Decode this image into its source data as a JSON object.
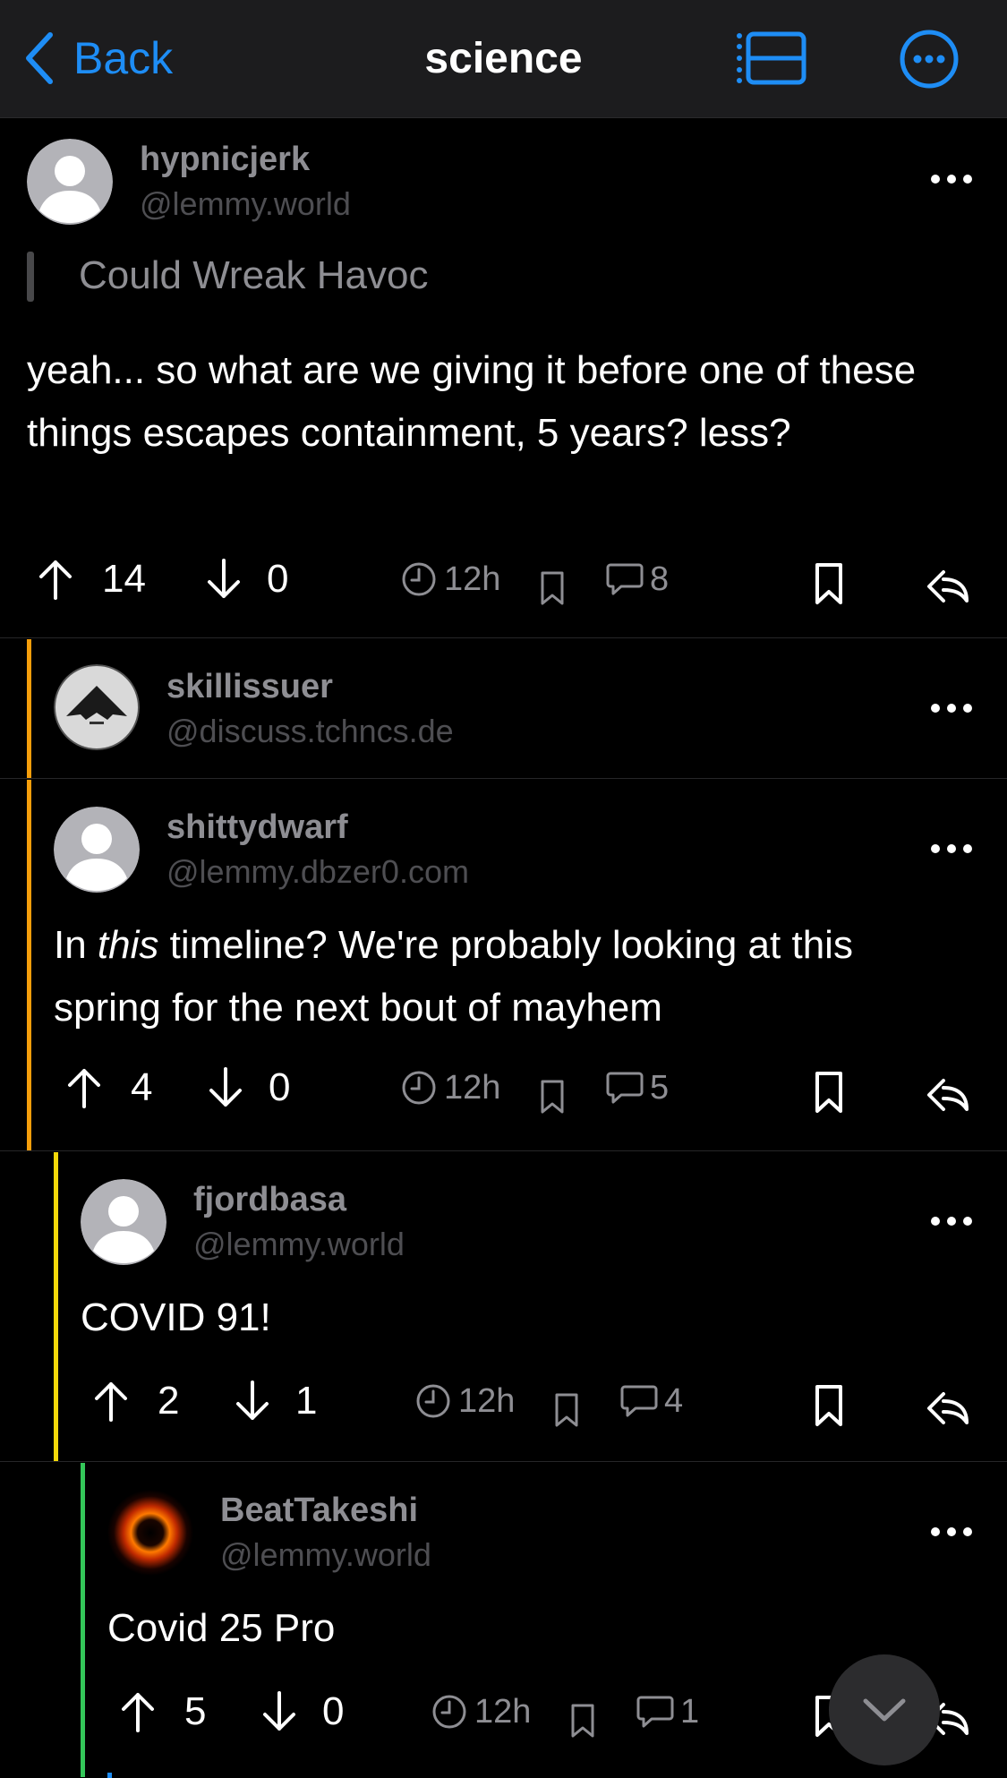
{
  "nav": {
    "back_label": "Back",
    "title": "science"
  },
  "comments": [
    {
      "username": "hypnicjerk",
      "instance": "@lemmy.world",
      "quote": "Could Wreak Havoc",
      "body": "yeah... so what are we giving it before one of these things escapes containment, 5 years? less?",
      "upvotes": "14",
      "downvotes": "0",
      "age": "12h",
      "replies": "8"
    },
    {
      "username": "skillissuer",
      "instance": "@discuss.tchncs.de",
      "depth_color": "#f59e0b"
    },
    {
      "username": "shittydwarf",
      "instance": "@lemmy.dbzer0.com",
      "body_pre": "In ",
      "body_em": "this",
      "body_post": " timeline? We're probably looking at this spring for the next bout of mayhem",
      "upvotes": "4",
      "downvotes": "0",
      "age": "12h",
      "replies": "5",
      "depth_color": "#f59e0b"
    },
    {
      "username": "fjordbasa",
      "instance": "@lemmy.world",
      "body": "COVID 91!",
      "upvotes": "2",
      "downvotes": "1",
      "age": "12h",
      "replies": "4",
      "depth_color": "#f5d90a"
    },
    {
      "username": "BeatTakeshi",
      "instance": "@lemmy.world",
      "body": "Covid 25 Pro",
      "upvotes": "5",
      "downvotes": "0",
      "age": "12h",
      "replies": "1",
      "depth_color": "#34c759"
    }
  ],
  "colors": {
    "accent": "#1e8df5",
    "background": "#000000",
    "secondary_text": "#8e8e93"
  },
  "icons": [
    "chevron-left-icon",
    "list-icon",
    "more-circle-icon",
    "upvote-icon",
    "downvote-icon",
    "clock-icon",
    "bookmark-icon",
    "reply-count-icon",
    "save-icon",
    "reply-icon",
    "scroll-down-icon"
  ]
}
